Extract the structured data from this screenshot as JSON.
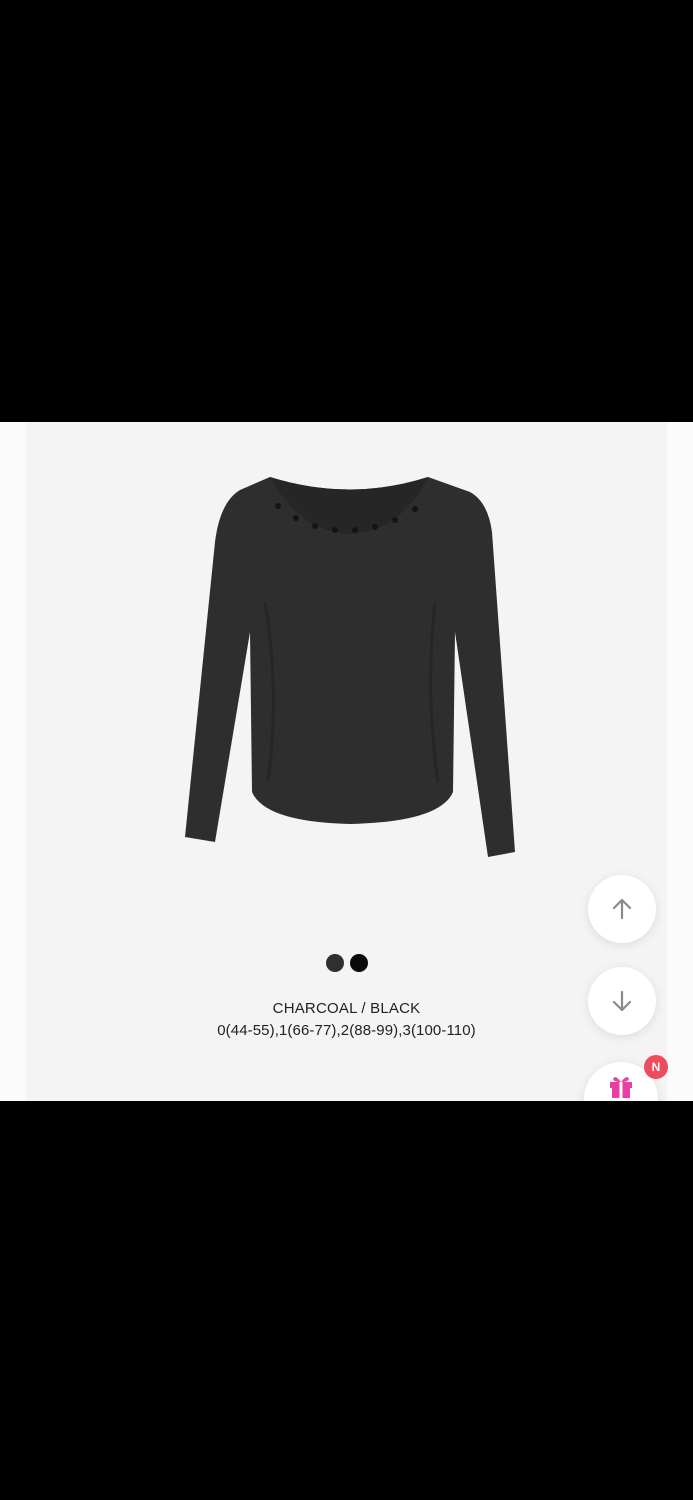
{
  "product": {
    "colors_label": "CHARCOAL / BLACK",
    "sizes_label": "0(44-55),1(66-77),2(88-99),3(100-110)",
    "swatches": [
      {
        "name": "charcoal",
        "color": "#2f2f2f"
      },
      {
        "name": "black",
        "color": "#0a0a0a"
      }
    ],
    "garment_color": "#2e2e2e"
  },
  "floating_buttons": {
    "scroll_up_icon": "arrow-up-icon",
    "scroll_down_icon": "arrow-down-icon",
    "gift_icon": "gift-icon",
    "gift_badge": "N"
  },
  "colors": {
    "background_panel": "#f4f4f4",
    "badge": "#ef4b5e",
    "gift_accent": "#e83fa6"
  }
}
